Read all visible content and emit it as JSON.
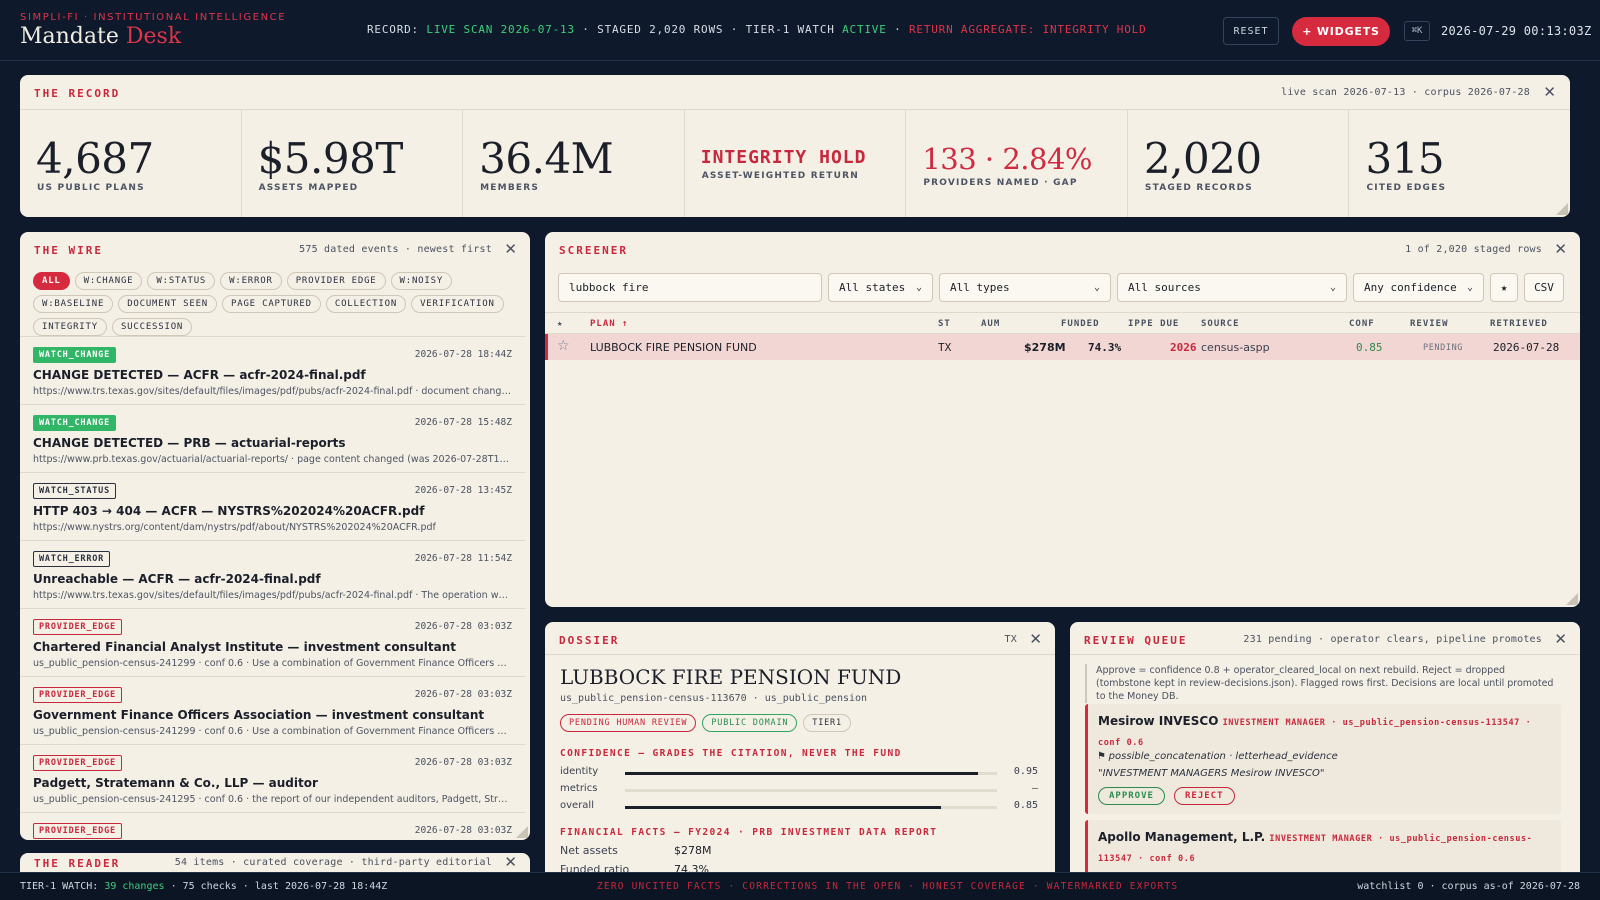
{
  "header": {
    "kicker": "SIMPLI-FI · INSTITUTIONAL INTELLIGENCE",
    "title_main": "Mandate",
    "title_accent": "Desk",
    "record_prefix": "RECORD:",
    "record_live": "LIVE SCAN 2026-07-13",
    "record_staged": "· STAGED 2,020 ROWS · TIER-1 WATCH",
    "record_active": "ACTIVE",
    "record_sep": "·",
    "record_return": "RETURN AGGREGATE: INTEGRITY HOLD",
    "reset_label": "RESET",
    "widgets_label": "+ WIDGETS",
    "kbd_label": "⌘K",
    "clock": "2026-07-29 00:13:03Z"
  },
  "record": {
    "title": "THE RECORD",
    "meta": "live scan 2026-07-13 · corpus 2026-07-28",
    "stats": [
      {
        "value": "4,687",
        "label": "US PUBLIC PLANS"
      },
      {
        "value": "$5.98T",
        "label": "ASSETS MAPPED"
      },
      {
        "value": "36.4M",
        "label": "MEMBERS"
      },
      {
        "value": "INTEGRITY HOLD",
        "label": "ASSET-WEIGHTED RETURN"
      },
      {
        "value": "133 · 2.84%",
        "label": "PROVIDERS NAMED · GAP"
      },
      {
        "value": "2,020",
        "label": "STAGED RECORDS"
      },
      {
        "value": "315",
        "label": "CITED EDGES"
      }
    ]
  },
  "wire": {
    "title": "THE WIRE",
    "meta": "575 dated events · newest first",
    "chips": [
      "ALL",
      "W:CHANGE",
      "W:STATUS",
      "W:ERROR",
      "PROVIDER EDGE",
      "W:NOISY",
      "W:BASELINE",
      "DOCUMENT SEEN",
      "PAGE CAPTURED",
      "COLLECTION",
      "VERIFICATION",
      "INTEGRITY",
      "SUCCESSION"
    ],
    "items": [
      {
        "tag": "WATCH_CHANGE",
        "time": "2026-07-28 18:44Z",
        "title": "CHANGE DETECTED — ACFR — acfr-2024-final.pdf",
        "sub": "https://www.trs.texas.gov/sites/default/files/images/pdf/pubs/acfr-2024-final.pdf · document changed ..."
      },
      {
        "tag": "WATCH_CHANGE",
        "time": "2026-07-28 15:48Z",
        "title": "CHANGE DETECTED — PRB — actuarial-reports",
        "sub": "https://www.prb.texas.gov/actuarial/actuarial-reports/ · page content changed (was 2026-07-28T13:43:..."
      },
      {
        "tag": "WATCH_STATUS",
        "time": "2026-07-28 13:45Z",
        "title": "HTTP 403 → 404 — ACFR — NYSTRS%202024%20ACFR.pdf",
        "sub": "https://www.nystrs.org/content/dam/nystrs/pdf/about/NYSTRS%202024%20ACFR.pdf"
      },
      {
        "tag": "WATCH_ERROR",
        "time": "2026-07-28 11:54Z",
        "title": "Unreachable — ACFR — acfr-2024-final.pdf",
        "sub": "https://www.trs.texas.gov/sites/default/files/images/pdf/pubs/acfr-2024-final.pdf · The operation was a..."
      },
      {
        "tag": "PROVIDER_EDGE",
        "time": "2026-07-28 03:03Z",
        "title": "Chartered Financial Analyst Institute — investment consultant",
        "sub": "us_public_pension-census-241299 · conf 0.6 · Use a combination of Government Finance Officers Asso..."
      },
      {
        "tag": "PROVIDER_EDGE",
        "time": "2026-07-28 03:03Z",
        "title": "Government Finance Officers Association — investment consultant",
        "sub": "us_public_pension-census-241299 · conf 0.6 · Use a combination of Government Finance Officers Asso..."
      },
      {
        "tag": "PROVIDER_EDGE",
        "time": "2026-07-28 03:03Z",
        "title": "Padgett, Stratemann & Co., LLP — auditor",
        "sub": "us_public_pension-census-241295 · conf 0.6 · the report of our independent auditors, Padgett, Stratem..."
      },
      {
        "tag": "PROVIDER_EDGE",
        "time": "2026-07-28 03:03Z",
        "title": "",
        "sub": ""
      }
    ]
  },
  "screener": {
    "title": "SCREENER",
    "meta": "1 of 2,020 staged rows",
    "search_value": "lubbock fire",
    "filters": [
      "All states",
      "All types",
      "All sources",
      "Any confidence"
    ],
    "star_label": "★",
    "csv_label": "CSV",
    "columns": [
      "★",
      "PLAN ↑",
      "ST",
      "AUM",
      "FUNDED",
      "IPPE DUE",
      "SOURCE",
      "CONF",
      "REVIEW",
      "RETRIEVED"
    ],
    "row": {
      "star": "☆",
      "plan": "LUBBOCK FIRE PENSION FUND",
      "st": "TX",
      "aum": "$278M",
      "funded": "74.3%",
      "due": "2026",
      "source": "census-aspp",
      "conf": "0.85",
      "review": "PENDING",
      "retrieved": "2026-07-28"
    }
  },
  "dossier": {
    "title": "DOSSIER",
    "state": "TX",
    "name": "LUBBOCK FIRE PENSION FUND",
    "id_line": "us_public_pension-census-113670 · us_public_pension",
    "pills": [
      "PENDING HUMAN REVIEW",
      "PUBLIC DOMAIN",
      "TIER1"
    ],
    "confidence_heading": "CONFIDENCE — GRADES THE CITATION, NEVER THE FUND",
    "confidence": [
      {
        "label": "identity",
        "value": "0.95",
        "fill": 0.95
      },
      {
        "label": "metrics",
        "value": "—",
        "fill": 0
      },
      {
        "label": "overall",
        "value": "0.85",
        "fill": 0.85
      }
    ],
    "facts_heading": "FINANCIAL FACTS — FY2024 · PRB INVESTMENT DATA REPORT",
    "facts": [
      {
        "label": "Net assets",
        "value": "$278M"
      },
      {
        "label": "Funded ratio",
        "value": "74.3%"
      }
    ]
  },
  "review": {
    "title": "REVIEW QUEUE",
    "meta": "231 pending · operator clears, pipeline promotes",
    "note": "Approve = confidence 0.8 + operator_cleared_local on next rebuild. Reject = dropped (tombstone kept in review-decisions.json). Flagged rows first. Decisions are local until promoted to the Money DB.",
    "cards": [
      {
        "name": "Mesirow INVESCO",
        "meta": "INVESTMENT MANAGER · us_public_pension-census-113547 · conf 0.6",
        "line1": "⚑ possible_concatenation · letterhead_evidence",
        "line2": "\"INVESTMENT MANAGERS Mesirow INVESCO\"",
        "approve": "APPROVE",
        "reject": "REJECT"
      },
      {
        "name": "Apollo Management, L.P.",
        "meta": "INVESTMENT MANAGER · us_public_pension-census-113547 · conf 0.6"
      }
    ]
  },
  "reader": {
    "title": "THE READER",
    "meta": "54 items · curated coverage · third-party editorial"
  },
  "footer": {
    "left_prefix": "TIER-1 WATCH:",
    "left_changes": "39 changes",
    "left_rest": "· 75 checks · last 2026-07-28 18:44Z",
    "mid": "ZERO UNCITED FACTS · CORRECTIONS IN THE OPEN · HONEST COVERAGE · WATERMARKED EXPORTS",
    "right": "watchlist 0 · corpus as-of 2026-07-28"
  }
}
